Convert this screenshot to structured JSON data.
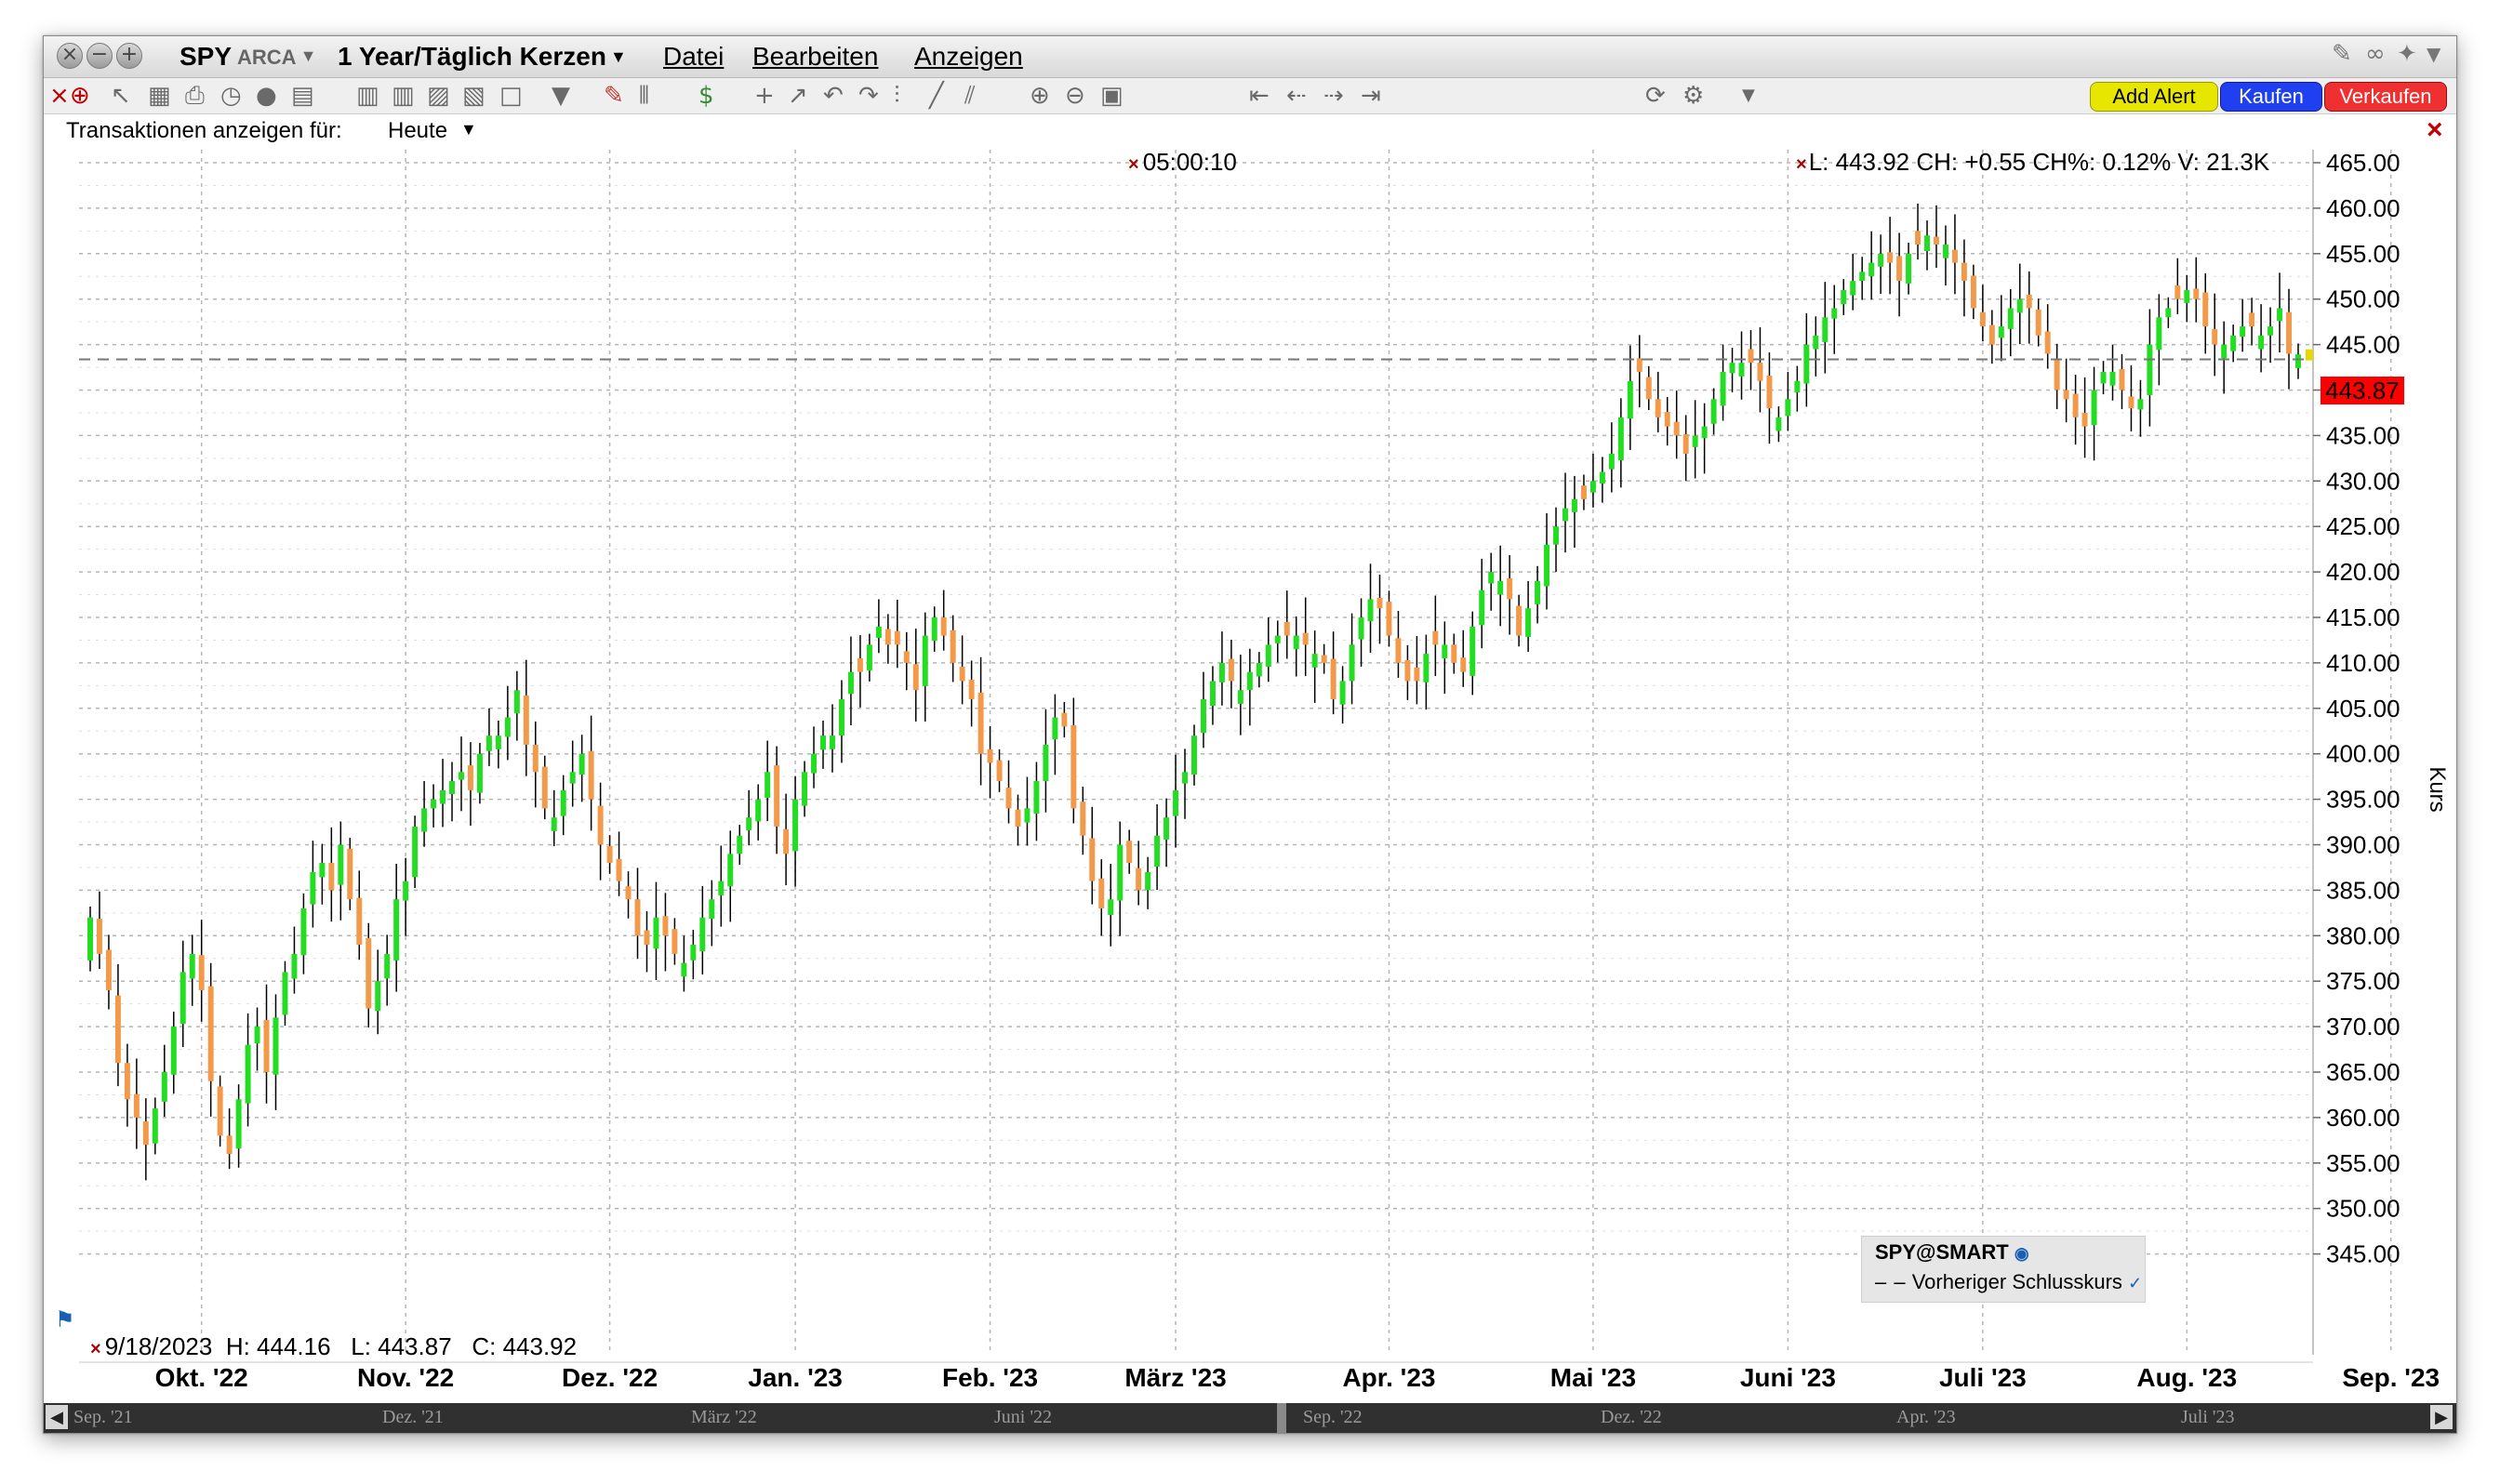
{
  "window": {
    "symbol": "SPY",
    "exchange": "ARCA",
    "period": "1 Year/Täglich Kerzen",
    "menu": [
      "Datei",
      "Bearbeiten",
      "Anzeigen"
    ]
  },
  "toolbar": {
    "add_alert": "Add Alert",
    "buy": "Kaufen",
    "sell": "Verkaufen",
    "colors": {
      "add_alert": "#e6e600",
      "buy": "#1f3ff0",
      "sell": "#f03030"
    }
  },
  "filter": {
    "label": "Transaktionen anzeigen für:",
    "value": "Heute"
  },
  "overlay": {
    "countdown": "05:00:10",
    "quote": "L: 443.92 CH: +0.55 CH%: 0.12% V: 21.3K",
    "last_price_tag": "443.87",
    "hover": {
      "date": "9/18/2023",
      "high": "H: 444.16",
      "low": "L: 443.87",
      "close": "C: 443.92"
    },
    "legend_title": "SPY@SMART",
    "legend_item": "Vorheriger Schlusskurs"
  },
  "scrollbar": {
    "labels": [
      "Sep. '21",
      "Dez. '21",
      "März '22",
      "Juni '22",
      "Sep. '22",
      "Dez. '22",
      "Apr. '23",
      "Juli '23"
    ]
  },
  "chart_data": {
    "type": "candlestick",
    "title": "",
    "xlabel": "",
    "ylabel": "Kurs",
    "ylim": [
      340,
      470
    ],
    "yticks": [
      345,
      350,
      355,
      360,
      365,
      370,
      375,
      380,
      385,
      390,
      395,
      400,
      405,
      410,
      415,
      420,
      425,
      430,
      435,
      440,
      445,
      450,
      455,
      460,
      465
    ],
    "x_tick_labels": [
      "Okt. '22",
      "Nov. '22",
      "Dez. '22",
      "Jan. '23",
      "Feb. '23",
      "März '23",
      "Apr. '23",
      "Mai '23",
      "Juni '23",
      "Juli '23",
      "Aug. '23",
      "Sep. '23"
    ],
    "x_tick_days": [
      12,
      34,
      56,
      76,
      97,
      117,
      140,
      162,
      183,
      204,
      226,
      248
    ],
    "reference_line": {
      "name": "Vorheriger Schlusskurs",
      "value": 443.37
    },
    "last_price": 443.87,
    "colors": {
      "up": "#22dd22",
      "down": "#f39a4a",
      "wick": "#000000"
    },
    "close": [
      382,
      378,
      374,
      366,
      362,
      360,
      357,
      361,
      365,
      370,
      376,
      378,
      374,
      364,
      358,
      356,
      362,
      368,
      370,
      365,
      371,
      376,
      378,
      383,
      387,
      388,
      385,
      390,
      384,
      379,
      372,
      375,
      378,
      384,
      386,
      392,
      394,
      395,
      396,
      397,
      398,
      396,
      400,
      402,
      402,
      404,
      407,
      401,
      398,
      394,
      393,
      396,
      398,
      400,
      395,
      390,
      388,
      386,
      384,
      380,
      379,
      382,
      380,
      378,
      377,
      379,
      382,
      384,
      386,
      389,
      391,
      393,
      395,
      398,
      392,
      389,
      395,
      398,
      400,
      402,
      402,
      406,
      409,
      409,
      412,
      414,
      412,
      412,
      410,
      407,
      413,
      415,
      413,
      410,
      408,
      406,
      400,
      399,
      397,
      394,
      392,
      394,
      397,
      401,
      404,
      403,
      394,
      391,
      386,
      383,
      384,
      390,
      388,
      385,
      387,
      391,
      393,
      396,
      398,
      402,
      406,
      408,
      410,
      408,
      407,
      409,
      410,
      412,
      413,
      413,
      413,
      412,
      411,
      410,
      406,
      408,
      412,
      415,
      417,
      416,
      413,
      410,
      408,
      408,
      411,
      412,
      412,
      410,
      409,
      414,
      418,
      420,
      419,
      417,
      413,
      416,
      419,
      423,
      425,
      427,
      428,
      428,
      430,
      431,
      433,
      437,
      441,
      442,
      439,
      437,
      436,
      435,
      433,
      435,
      436,
      439,
      442,
      443,
      443,
      443,
      441,
      438,
      437,
      439,
      441,
      445,
      446,
      448,
      449,
      451,
      452,
      453,
      454,
      455,
      454,
      452,
      455,
      456,
      457,
      456,
      456,
      454,
      452,
      449,
      447,
      445,
      447,
      449,
      450,
      449,
      446,
      444,
      440,
      439,
      437,
      436,
      440,
      442,
      442,
      440,
      438,
      439,
      445,
      448,
      449,
      450,
      451,
      450,
      447,
      445,
      445,
      446,
      447,
      447,
      446,
      447,
      449,
      444,
      443.92
    ]
  }
}
